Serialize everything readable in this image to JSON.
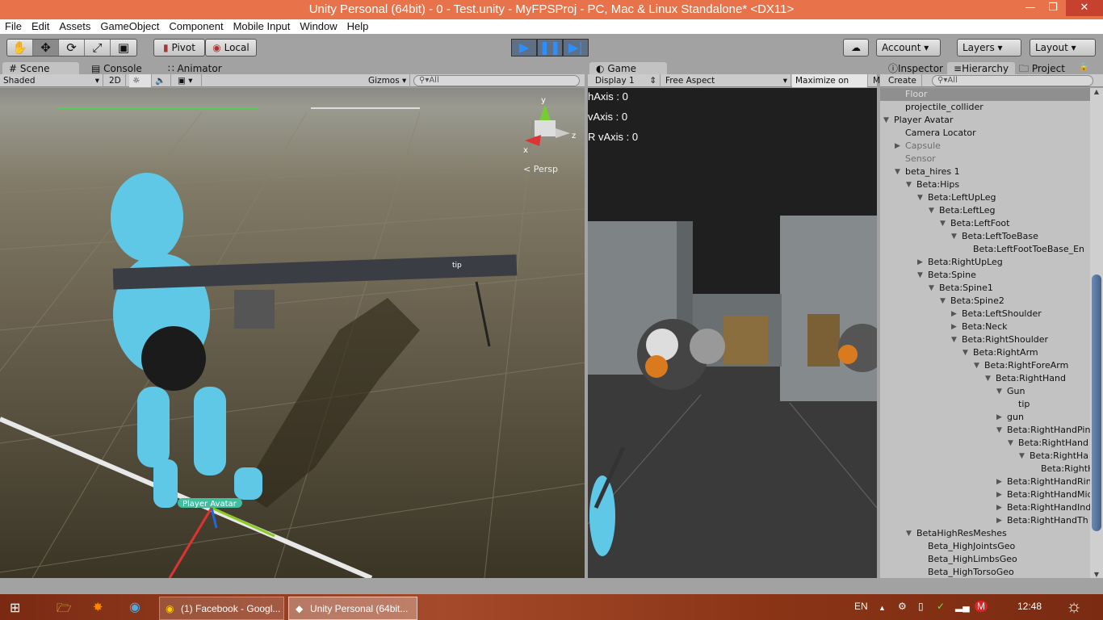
{
  "window": {
    "title": "Unity Personal (64bit) - 0 - Test.unity - MyFPSProj - PC, Mac & Linux Standalone* <DX11>"
  },
  "menu": [
    "File",
    "Edit",
    "Assets",
    "GameObject",
    "Component",
    "Mobile Input",
    "Window",
    "Help"
  ],
  "toolbar": {
    "pivot": "Pivot",
    "local": "Local",
    "account": "Account",
    "layers": "Layers",
    "layout": "Layout"
  },
  "tabs": {
    "scene": "Scene",
    "console": "Console",
    "animator": "Animator",
    "game": "Game",
    "inspector": "Inspector",
    "hierarchy": "Hierarchy",
    "project": "Project"
  },
  "scene_bar": {
    "shading": "Shaded",
    "mode2d": "2D",
    "gizmos": "Gizmos",
    "search_placeholder": "All"
  },
  "scene": {
    "persp": "Persp",
    "axis_y": "y",
    "axis_x": "x",
    "axis_z": "z",
    "tip_label": "tip",
    "player_label": "Player Avatar"
  },
  "game_bar": {
    "display": "Display 1",
    "aspect": "Free Aspect",
    "maximize": "Maximize on Play",
    "more": "M"
  },
  "game_hud": [
    "hAxis : 0",
    "vAxis : 0",
    "R vAxis : 0"
  ],
  "hierarchy_bar": {
    "create": "Create",
    "search_placeholder": "All"
  },
  "hierarchy": [
    {
      "name": "Floor",
      "level": 1,
      "arrow": "none",
      "selected": true
    },
    {
      "name": "projectile_collider",
      "level": 1,
      "arrow": "none"
    },
    {
      "name": "Player Avatar",
      "level": 0,
      "arrow": "down"
    },
    {
      "name": "Camera Locator",
      "level": 1,
      "arrow": "none"
    },
    {
      "name": "Capsule",
      "level": 1,
      "arrow": "right",
      "inactive": true
    },
    {
      "name": "Sensor",
      "level": 1,
      "arrow": "none",
      "inactive": true
    },
    {
      "name": "beta_hires 1",
      "level": 1,
      "arrow": "down"
    },
    {
      "name": "Beta:Hips",
      "level": 2,
      "arrow": "down"
    },
    {
      "name": "Beta:LeftUpLeg",
      "level": 3,
      "arrow": "down"
    },
    {
      "name": "Beta:LeftLeg",
      "level": 4,
      "arrow": "down"
    },
    {
      "name": "Beta:LeftFoot",
      "level": 5,
      "arrow": "down"
    },
    {
      "name": "Beta:LeftToeBase",
      "level": 6,
      "arrow": "down"
    },
    {
      "name": "Beta:LeftFootToeBase_En",
      "level": 7,
      "arrow": "none"
    },
    {
      "name": "Beta:RightUpLeg",
      "level": 3,
      "arrow": "right"
    },
    {
      "name": "Beta:Spine",
      "level": 3,
      "arrow": "down"
    },
    {
      "name": "Beta:Spine1",
      "level": 4,
      "arrow": "down"
    },
    {
      "name": "Beta:Spine2",
      "level": 5,
      "arrow": "down"
    },
    {
      "name": "Beta:LeftShoulder",
      "level": 6,
      "arrow": "right"
    },
    {
      "name": "Beta:Neck",
      "level": 6,
      "arrow": "right"
    },
    {
      "name": "Beta:RightShoulder",
      "level": 6,
      "arrow": "down"
    },
    {
      "name": "Beta:RightArm",
      "level": 7,
      "arrow": "down"
    },
    {
      "name": "Beta:RightForeArm",
      "level": 8,
      "arrow": "down"
    },
    {
      "name": "Beta:RightHand",
      "level": 9,
      "arrow": "down"
    },
    {
      "name": "Gun",
      "level": 10,
      "arrow": "down"
    },
    {
      "name": "tip",
      "level": 11,
      "arrow": "none"
    },
    {
      "name": "gun",
      "level": 10,
      "arrow": "right"
    },
    {
      "name": "Beta:RightHandPin",
      "level": 10,
      "arrow": "down"
    },
    {
      "name": "Beta:RightHand",
      "level": 11,
      "arrow": "down"
    },
    {
      "name": "Beta:RightHa",
      "level": 12,
      "arrow": "down"
    },
    {
      "name": "Beta:RightH",
      "level": 13,
      "arrow": "none"
    },
    {
      "name": "Beta:RightHandRin",
      "level": 10,
      "arrow": "right"
    },
    {
      "name": "Beta:RightHandMid",
      "level": 10,
      "arrow": "right"
    },
    {
      "name": "Beta:RightHandInd",
      "level": 10,
      "arrow": "right"
    },
    {
      "name": "Beta:RightHandTh",
      "level": 10,
      "arrow": "right"
    },
    {
      "name": "BetaHighResMeshes",
      "level": 2,
      "arrow": "down"
    },
    {
      "name": "Beta_HighJointsGeo",
      "level": 3,
      "arrow": "none"
    },
    {
      "name": "Beta_HighLimbsGeo",
      "level": 3,
      "arrow": "none"
    },
    {
      "name": "Beta_HighTorsoGeo",
      "level": 3,
      "arrow": "none"
    }
  ],
  "taskbar": {
    "items": [
      "(1) Facebook - Googl...",
      "Unity Personal (64bit..."
    ],
    "lang": "EN",
    "time": "12:48"
  },
  "colors": {
    "title": "#e8734a",
    "play": "#2c8fff",
    "selection": "#8f8f8f"
  }
}
